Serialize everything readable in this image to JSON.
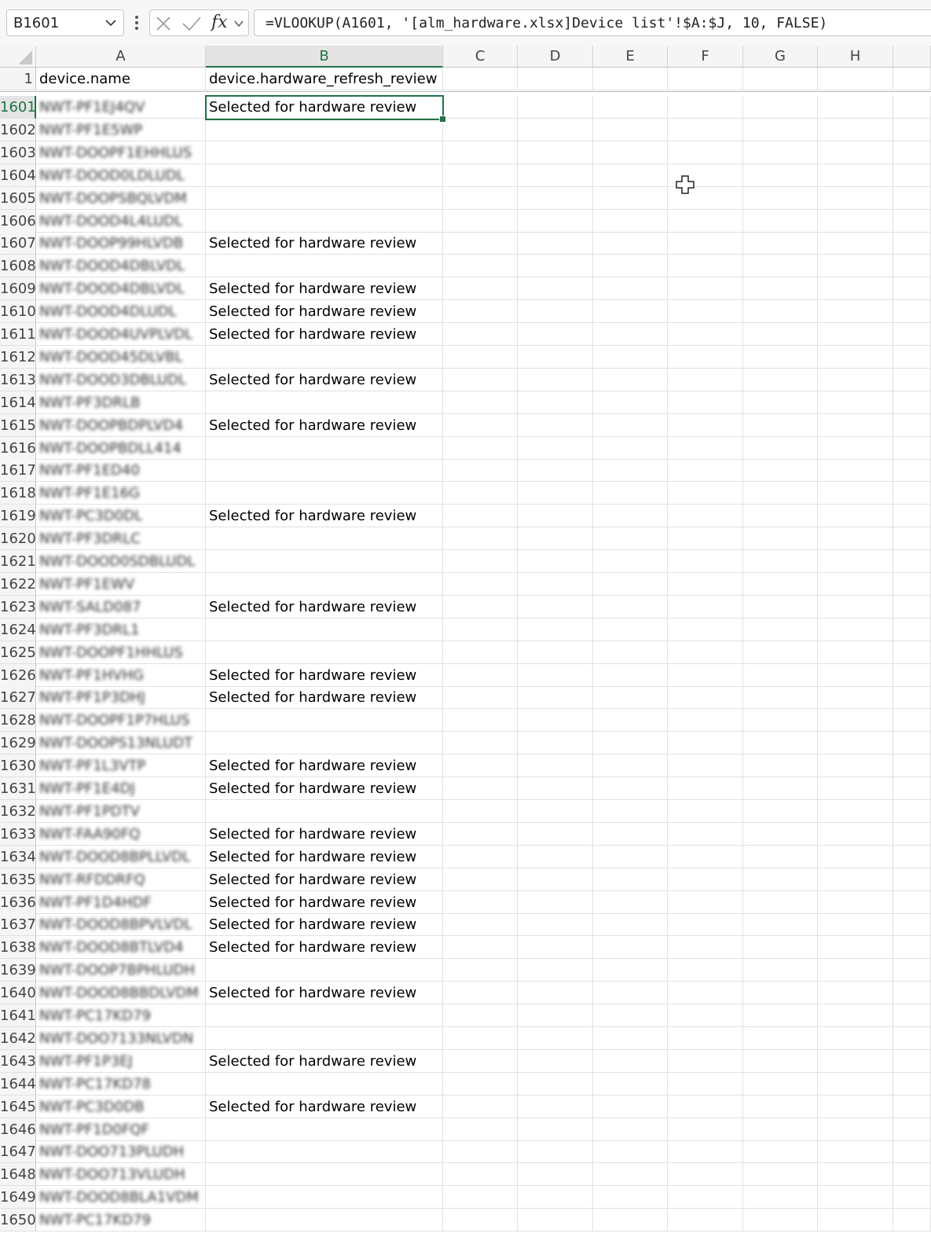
{
  "formula_bar": {
    "name_box": "B1601",
    "formula": "=VLOOKUP(A1601, '[alm_hardware.xlsx]Device list'!$A:$J, 10, FALSE)",
    "fx_label": "fx"
  },
  "columns": [
    "A",
    "B",
    "C",
    "D",
    "E",
    "F",
    "G",
    "H"
  ],
  "header_row": {
    "number": "1",
    "a": "device.name",
    "b": "device.hardware_refresh_review"
  },
  "rows": [
    {
      "n": "1601",
      "a": "NWT-PF1EJ4QV",
      "b": "Selected for hardware review"
    },
    {
      "n": "1602",
      "a": "NWT-PF1E5WP",
      "b": ""
    },
    {
      "n": "1603",
      "a": "NWT-DOOPF1EHHLUS",
      "b": ""
    },
    {
      "n": "1604",
      "a": "NWT-DOOD0LDLUDL",
      "b": ""
    },
    {
      "n": "1605",
      "a": "NWT-DOOPSBQLVDM",
      "b": ""
    },
    {
      "n": "1606",
      "a": "NWT-DOOD4L4LUDL",
      "b": ""
    },
    {
      "n": "1607",
      "a": "NWT-DOOP99HLVDB",
      "b": "Selected for hardware review"
    },
    {
      "n": "1608",
      "a": "NWT-DOOD4DBLVDL",
      "b": ""
    },
    {
      "n": "1609",
      "a": "NWT-DOOD4DBLVDL",
      "b": "Selected for hardware review"
    },
    {
      "n": "1610",
      "a": "NWT-DOOD4DLUDL",
      "b": "Selected for hardware review"
    },
    {
      "n": "1611",
      "a": "NWT-DOOD4UVPLVDL",
      "b": "Selected for hardware review"
    },
    {
      "n": "1612",
      "a": "NWT-DOOD45DLVBL",
      "b": ""
    },
    {
      "n": "1613",
      "a": "NWT-DOOD3DBLUDL",
      "b": "Selected for hardware review"
    },
    {
      "n": "1614",
      "a": "NWT-PF3DRLB",
      "b": ""
    },
    {
      "n": "1615",
      "a": "NWT-DOOPBDPLVD4",
      "b": "Selected for hardware review"
    },
    {
      "n": "1616",
      "a": "NWT-DOOPBDLL414",
      "b": ""
    },
    {
      "n": "1617",
      "a": "NWT-PF1ED40",
      "b": ""
    },
    {
      "n": "1618",
      "a": "NWT-PF1E16G",
      "b": ""
    },
    {
      "n": "1619",
      "a": "NWT-PC3D0DL",
      "b": "Selected for hardware review"
    },
    {
      "n": "1620",
      "a": "NWT-PF3DRLC",
      "b": ""
    },
    {
      "n": "1621",
      "a": "NWT-DOOD0SDBLUDL",
      "b": ""
    },
    {
      "n": "1622",
      "a": "NWT-PF1EWV",
      "b": ""
    },
    {
      "n": "1623",
      "a": "NWT-SALD087",
      "b": "Selected for hardware review"
    },
    {
      "n": "1624",
      "a": "NWT-PF3DRL1",
      "b": ""
    },
    {
      "n": "1625",
      "a": "NWT-DOOPF1HHLUS",
      "b": ""
    },
    {
      "n": "1626",
      "a": "NWT-PF1HVHG",
      "b": "Selected for hardware review"
    },
    {
      "n": "1627",
      "a": "NWT-PF1P3DHJ",
      "b": "Selected for hardware review"
    },
    {
      "n": "1628",
      "a": "NWT-DOOPF1P7HLUS",
      "b": ""
    },
    {
      "n": "1629",
      "a": "NWT-DOOPS13NLUDT",
      "b": ""
    },
    {
      "n": "1630",
      "a": "NWT-PF1L3VTP",
      "b": "Selected for hardware review"
    },
    {
      "n": "1631",
      "a": "NWT-PF1E4DJ",
      "b": "Selected for hardware review"
    },
    {
      "n": "1632",
      "a": "NWT-PF1PDTV",
      "b": ""
    },
    {
      "n": "1633",
      "a": "NWT-FAA90FQ",
      "b": "Selected for hardware review"
    },
    {
      "n": "1634",
      "a": "NWT-DOOD8BPLLVDL",
      "b": "Selected for hardware review"
    },
    {
      "n": "1635",
      "a": "NWT-RFDDRFQ",
      "b": "Selected for hardware review"
    },
    {
      "n": "1636",
      "a": "NWT-PF1D4HDF",
      "b": "Selected for hardware review"
    },
    {
      "n": "1637",
      "a": "NWT-DOOD8BPVLVDL",
      "b": "Selected for hardware review"
    },
    {
      "n": "1638",
      "a": "NWT-DOOD8BTLVD4",
      "b": "Selected for hardware review"
    },
    {
      "n": "1639",
      "a": "NWT-DOOP7BPHLUDH",
      "b": ""
    },
    {
      "n": "1640",
      "a": "NWT-DOOD8BBDLVDM",
      "b": "Selected for hardware review"
    },
    {
      "n": "1641",
      "a": "NWT-PC17KD79",
      "b": ""
    },
    {
      "n": "1642",
      "a": "NWT-DOO7133NLVDN",
      "b": ""
    },
    {
      "n": "1643",
      "a": "NWT-PF1P3EJ",
      "b": "Selected for hardware review"
    },
    {
      "n": "1644",
      "a": "NWT-PC17KD78",
      "b": ""
    },
    {
      "n": "1645",
      "a": "NWT-PC3D0DB",
      "b": "Selected for hardware review"
    },
    {
      "n": "1646",
      "a": "NWT-PF1D0FQF",
      "b": ""
    },
    {
      "n": "1647",
      "a": "NWT-DOO713PLUDH",
      "b": ""
    },
    {
      "n": "1648",
      "a": "NWT-DOO713VLUDH",
      "b": ""
    },
    {
      "n": "1649",
      "a": "NWT-DOOD8BLA1VDM",
      "b": ""
    },
    {
      "n": "1650",
      "a": "NWT-PC17KD79",
      "b": ""
    }
  ],
  "colors": {
    "accent": "#217346",
    "grid": "#e1e1e1",
    "header_bg": "#f5f5f5"
  }
}
